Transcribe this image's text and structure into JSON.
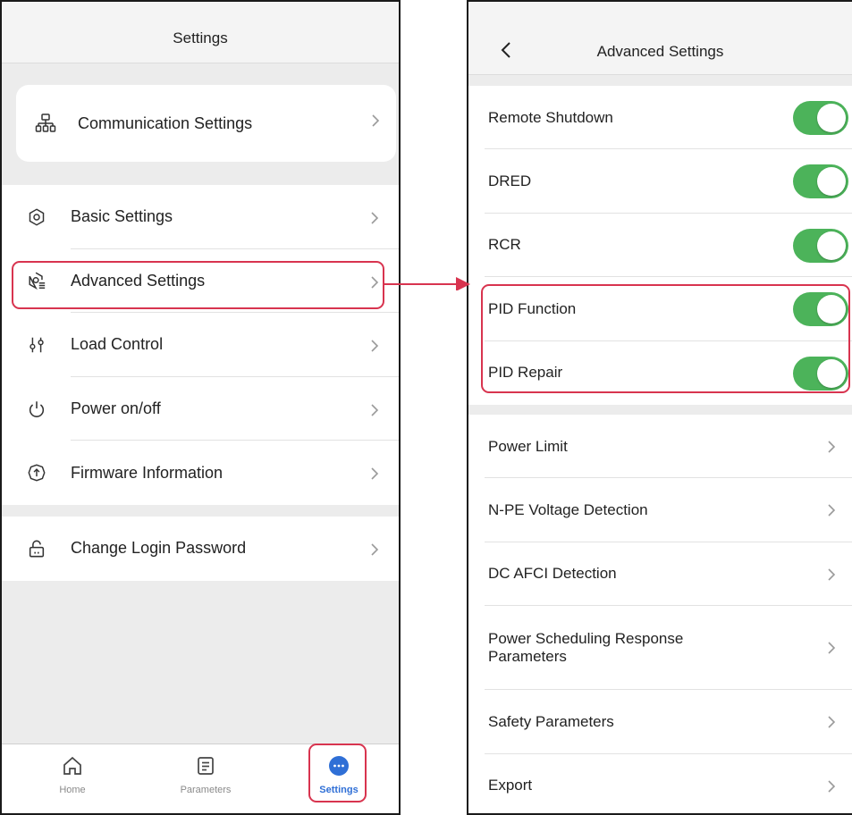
{
  "left_screen": {
    "title": "Settings",
    "communication": {
      "label": "Communication Settings",
      "icon": "network-icon"
    },
    "items": [
      {
        "label": "Basic Settings",
        "icon": "gear-icon"
      },
      {
        "label": "Advanced Settings",
        "icon": "gear-list-icon"
      },
      {
        "label": "Load Control",
        "icon": "sliders-icon"
      },
      {
        "label": "Power on/off",
        "icon": "power-icon"
      },
      {
        "label": "Firmware Information",
        "icon": "firmware-icon"
      }
    ],
    "password": {
      "label": "Change Login Password",
      "icon": "lock-icon"
    },
    "tabs": [
      {
        "label": "Home",
        "icon": "home-icon"
      },
      {
        "label": "Parameters",
        "icon": "document-icon"
      },
      {
        "label": "Settings",
        "icon": "more-icon",
        "active": true
      }
    ]
  },
  "right_screen": {
    "title": "Advanced Settings",
    "toggles": [
      {
        "label": "Remote Shutdown",
        "on": true
      },
      {
        "label": "DRED",
        "on": true
      },
      {
        "label": "RCR",
        "on": true
      },
      {
        "label": "PID Function",
        "on": true
      },
      {
        "label": "PID Repair",
        "on": true
      }
    ],
    "links": [
      {
        "label": "Power Limit"
      },
      {
        "label": "N-PE Voltage Detection"
      },
      {
        "label": "DC AFCI Detection"
      },
      {
        "label": "Power Scheduling Response Parameters"
      },
      {
        "label": "Safety Parameters"
      },
      {
        "label": "Export"
      }
    ]
  },
  "colors": {
    "highlight": "#d8344f",
    "toggle_on": "#4cb35a",
    "tab_active": "#2f6fd6"
  }
}
